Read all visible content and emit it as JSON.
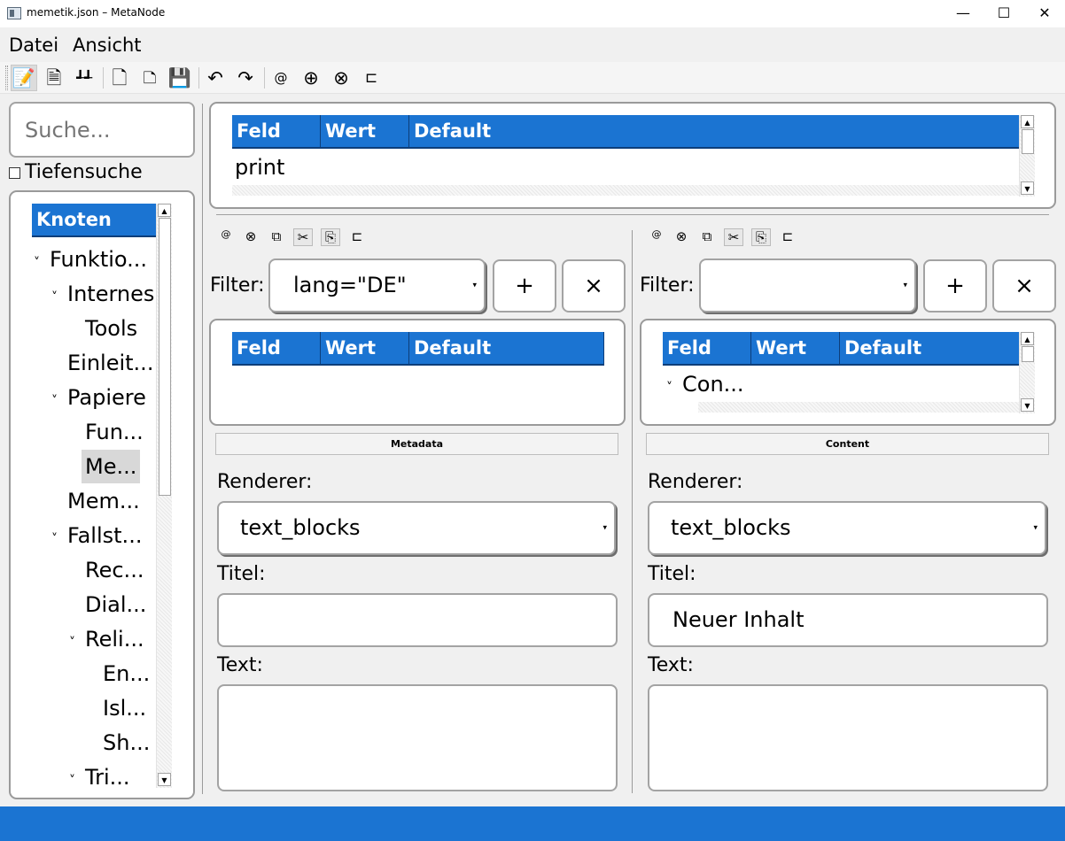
{
  "window": {
    "title": "memetik.json – MetaNode",
    "min_glyph": "—",
    "max_glyph": "☐",
    "close_glyph": "✕"
  },
  "menu": {
    "file": "Datei",
    "view": "Ansicht"
  },
  "toolbar": {
    "icons": [
      "edit-icon",
      "document-icon",
      "node-link-icon",
      "new-file-icon",
      "blank-file-icon",
      "save-icon",
      "undo-icon",
      "redo-icon",
      "at-icon",
      "add-circle-icon",
      "remove-circle-icon",
      "tag-icon"
    ],
    "glyphs": [
      "📝",
      "🗎",
      "┹┹",
      "🗋",
      "🗅",
      "💾",
      "↶",
      "↷",
      "@",
      "⊕",
      "⊗",
      "⊏"
    ]
  },
  "search": {
    "placeholder": "Suche..."
  },
  "deep_search": {
    "label": "Tiefensuche",
    "checked": false
  },
  "tree": {
    "header": "Knoten",
    "items": [
      {
        "label": "Funktio...",
        "chevron": "˅"
      },
      {
        "label": "Internes",
        "chevron": "˅"
      },
      {
        "label": "Tools",
        "chevron": ""
      },
      {
        "label": "Einleit...",
        "chevron": ""
      },
      {
        "label": "Papiere",
        "chevron": "˅"
      },
      {
        "label": "Fun...",
        "chevron": ""
      },
      {
        "label": "Me...",
        "chevron": ""
      },
      {
        "label": "Mem...",
        "chevron": ""
      },
      {
        "label": "Fallst...",
        "chevron": "˅"
      },
      {
        "label": "Rec...",
        "chevron": ""
      },
      {
        "label": "Dial...",
        "chevron": ""
      },
      {
        "label": "Reli...",
        "chevron": "˅"
      },
      {
        "label": "En...",
        "chevron": ""
      },
      {
        "label": "Isl...",
        "chevron": ""
      },
      {
        "label": "Sh...",
        "chevron": ""
      },
      {
        "label": "Tri...",
        "chevron": "˅"
      }
    ]
  },
  "top_table": {
    "columns": [
      "Feld",
      "Wert",
      "Default"
    ],
    "rows": [
      "print"
    ]
  },
  "left_panel": {
    "icons": [
      "@",
      "⊗",
      "⧉",
      "✂",
      "⎘",
      "⊏"
    ],
    "filter_label": "Filter:",
    "filter_value": "lang=\"DE\"",
    "add": "+",
    "clear": "×",
    "table_columns": [
      "Feld",
      "Wert",
      "Default"
    ],
    "section": "Metadata",
    "renderer_label": "Renderer:",
    "renderer_value": "text_blocks",
    "title_label": "Titel:",
    "title_value": "",
    "text_label": "Text:",
    "text_value": ""
  },
  "right_panel": {
    "icons": [
      "@",
      "⊗",
      "⧉",
      "✂",
      "⎘",
      "⊏"
    ],
    "filter_label": "Filter:",
    "filter_value": "",
    "add": "+",
    "clear": "×",
    "table_columns": [
      "Feld",
      "Wert",
      "Default"
    ],
    "table_row": {
      "chevron": "˅",
      "label": "Con..."
    },
    "section": "Content",
    "renderer_label": "Renderer:",
    "renderer_value": "text_blocks",
    "title_label": "Titel:",
    "title_value": "Neuer Inhalt",
    "text_label": "Text:",
    "text_value": ""
  },
  "colors": {
    "accent": "#1b74d2",
    "header_border": "#0d3e7a",
    "frame": "#9a9a9a",
    "selection": "#d8d8d8"
  }
}
